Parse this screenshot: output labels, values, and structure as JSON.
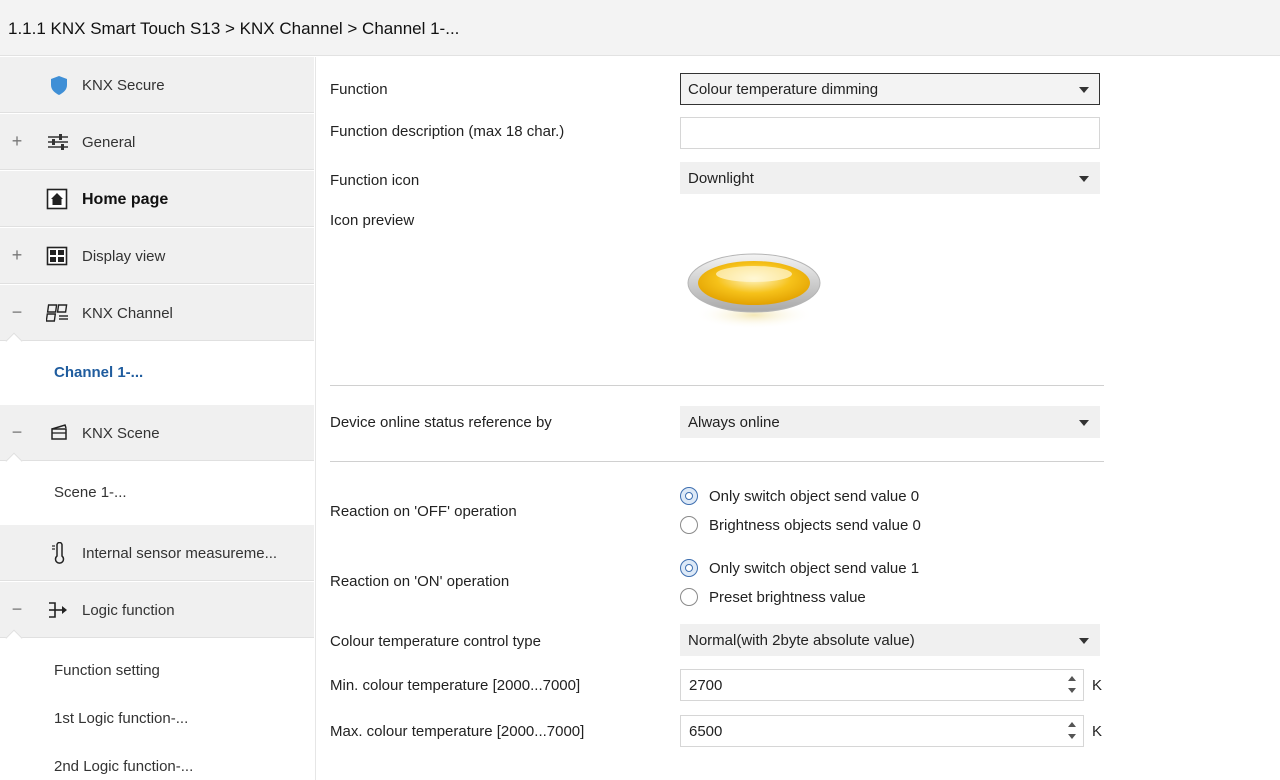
{
  "breadcrumb": "1.1.1 KNX Smart Touch S13 > KNX Channel  > Channel 1-...",
  "sidebar": {
    "items": [
      {
        "label": "KNX Secure",
        "icon": "shield-icon",
        "expander": ""
      },
      {
        "label": "General",
        "icon": "sliders-icon",
        "expander": "+"
      },
      {
        "label": "Home page",
        "icon": "home-icon",
        "expander": ""
      },
      {
        "label": "Display view",
        "icon": "grid-view-icon",
        "expander": "+"
      },
      {
        "label": "KNX Channel",
        "icon": "channel-icon",
        "expander": "−"
      },
      {
        "label": "Channel 1-...",
        "icon": "",
        "expander": ""
      },
      {
        "label": "KNX Scene",
        "icon": "scene-icon",
        "expander": "−"
      },
      {
        "label": "Scene 1-...",
        "icon": "",
        "expander": ""
      },
      {
        "label": "Internal sensor measureme...",
        "icon": "thermometer-icon",
        "expander": ""
      },
      {
        "label": "Logic function",
        "icon": "logic-icon",
        "expander": "−"
      },
      {
        "label": "Function setting",
        "icon": "",
        "expander": ""
      },
      {
        "label": "1st Logic function-...",
        "icon": "",
        "expander": ""
      },
      {
        "label": "2nd Logic function-...",
        "icon": "",
        "expander": ""
      }
    ]
  },
  "form": {
    "function_label": "Function",
    "function_value": "Colour temperature dimming",
    "description_label": "Function description (max 18 char.)",
    "description_value": "",
    "icon_label": "Function icon",
    "icon_value": "Downlight",
    "preview_label": "Icon preview",
    "online_label": "Device online status reference by",
    "online_value": "Always online",
    "off_label": "Reaction on 'OFF' operation",
    "off_options": [
      "Only switch object send value 0",
      "Brightness objects send value 0"
    ],
    "off_selected": 0,
    "on_label": "Reaction on 'ON' operation",
    "on_options": [
      "Only switch object send value 1",
      "Preset brightness value"
    ],
    "on_selected": 0,
    "ct_type_label": "Colour temperature control type",
    "ct_type_value": "Normal(with 2byte absolute value)",
    "min_label": "Min. colour temperature [2000...7000]",
    "min_value": "2700",
    "max_label": "Max. colour temperature [2000...7000]",
    "max_value": "6500",
    "unit": "K"
  },
  "colors": {
    "accent": "#1f5c9e",
    "shield": "#3f8fd6",
    "lamp_fill": "#f2b705",
    "lamp_rim": "#c9c9c9"
  }
}
